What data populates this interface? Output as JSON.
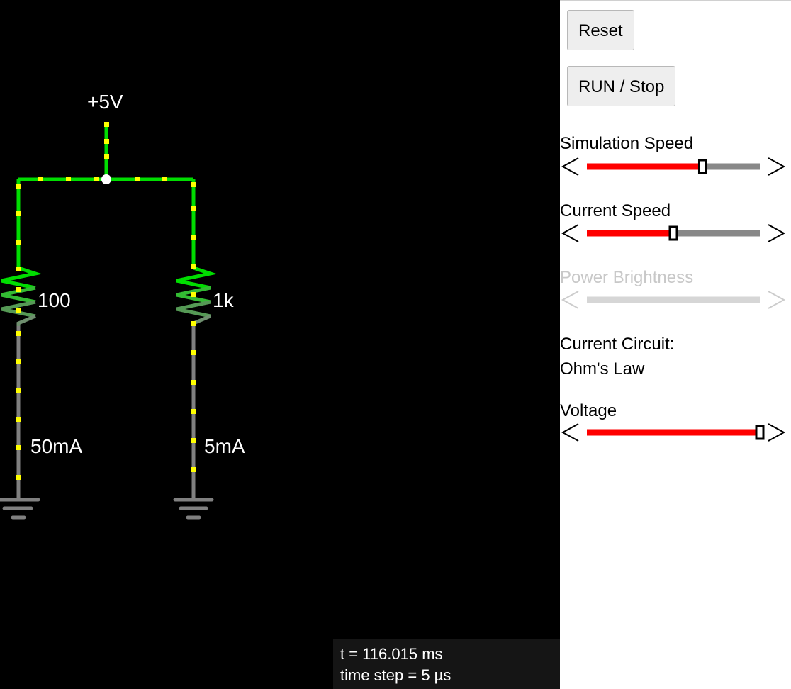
{
  "circuit": {
    "supply_label": "+5V",
    "resistors": [
      {
        "value_label": "100",
        "current_label": "50mA"
      },
      {
        "value_label": "1k",
        "current_label": "5mA"
      }
    ]
  },
  "status": {
    "time": "t = 116.015 ms",
    "time_step": "time step = 5 µs"
  },
  "controls": {
    "reset_label": "Reset",
    "run_stop_label": "RUN / Stop",
    "sliders": [
      {
        "label": "Simulation Speed",
        "value_fraction": 0.67,
        "enabled": true
      },
      {
        "label": "Current Speed",
        "value_fraction": 0.5,
        "enabled": true
      },
      {
        "label": "Power Brightness",
        "value_fraction": 0.5,
        "enabled": false
      }
    ],
    "current_circuit_heading": "Current Circuit:",
    "current_circuit_name": "Ohm's Law",
    "voltage_slider": {
      "label": "Voltage",
      "value_fraction": 1.0,
      "enabled": true
    }
  },
  "colors": {
    "wire_high": "#00dd00",
    "wire_low": "#808080",
    "current_dot": "#ffff00",
    "slider_fill": "#ff0000",
    "slider_track": "#888888"
  }
}
